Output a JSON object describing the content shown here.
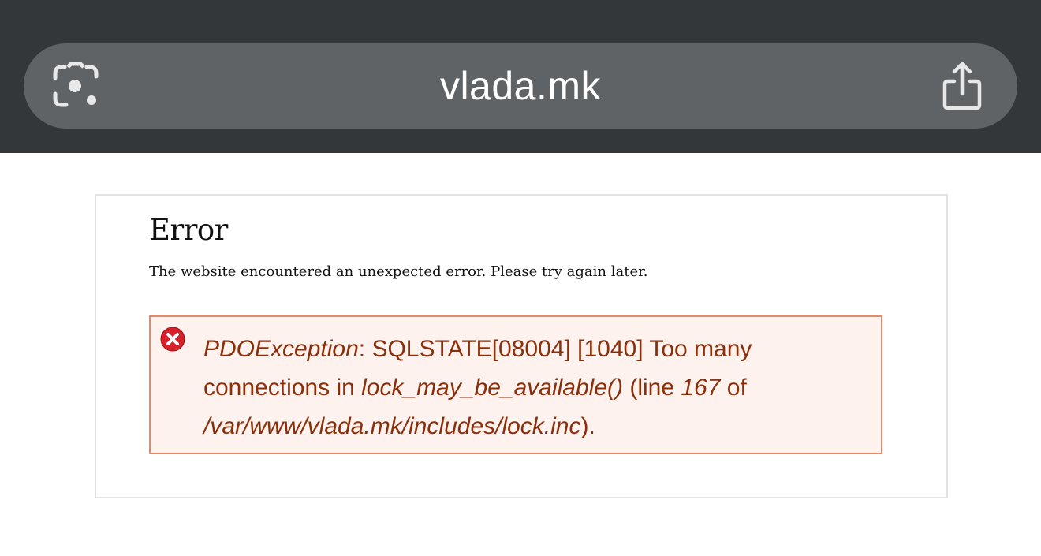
{
  "browser": {
    "url": "vlada.mk",
    "lens_icon": "visual-search-icon",
    "share_icon": "share-icon"
  },
  "page": {
    "title": "Error",
    "description": "The website encountered an unexpected error. Please try again later."
  },
  "error_message": {
    "icon": "error-x-icon",
    "exception": "PDOException",
    "sep1": ": ",
    "text1": "SQLSTATE[08004] [1040] Too many connections in ",
    "function": "lock_may_be_available()",
    "text2": " (line ",
    "line": "167",
    "text3": " of ",
    "file": "/var/www/vlada.mk/includes/lock.inc",
    "text4": ")."
  },
  "colors": {
    "toolbar_bg": "#34373a",
    "urlbar_bg": "#5f6366",
    "message_border": "#e38a6a",
    "message_bg": "#fdf2ee",
    "message_text": "#8b2f0b",
    "error_icon_red": "#d6202a"
  }
}
